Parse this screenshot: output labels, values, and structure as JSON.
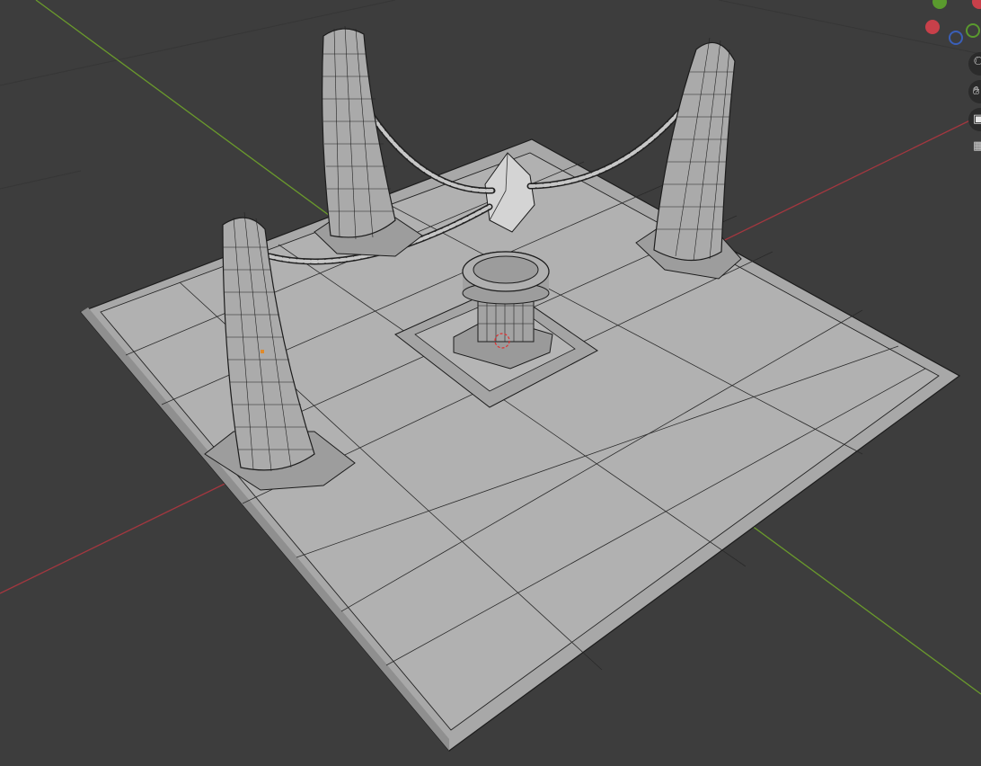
{
  "viewport": {
    "mode": "edit-mode-wireframe-overlay",
    "background_color": "#3d3d3d",
    "mesh_color": "#a9a9a9",
    "wire_color": "#1a1a1a",
    "axis_x_color": "#a3373f",
    "axis_y_color": "#6a9a2c",
    "objects": [
      "floor-tile",
      "pillar-left",
      "pillar-back",
      "pillar-right",
      "pedestal",
      "crystal",
      "chains"
    ]
  },
  "gizmo": {
    "axes": [
      {
        "name": "x-axis-ball",
        "color": "#c8404a"
      },
      {
        "name": "y-axis-ball",
        "color": "#5a9a2e"
      },
      {
        "name": "neg-y-axis-ball",
        "color": "#3a5fb8"
      },
      {
        "name": "z-axis-ball",
        "color": "#5a9a2e"
      }
    ]
  },
  "navigation": {
    "zoom_icon": "magnifier-icon",
    "pan_icon": "hand-icon",
    "camera_icon": "camera-icon",
    "perspective_icon": "grid-icon"
  }
}
